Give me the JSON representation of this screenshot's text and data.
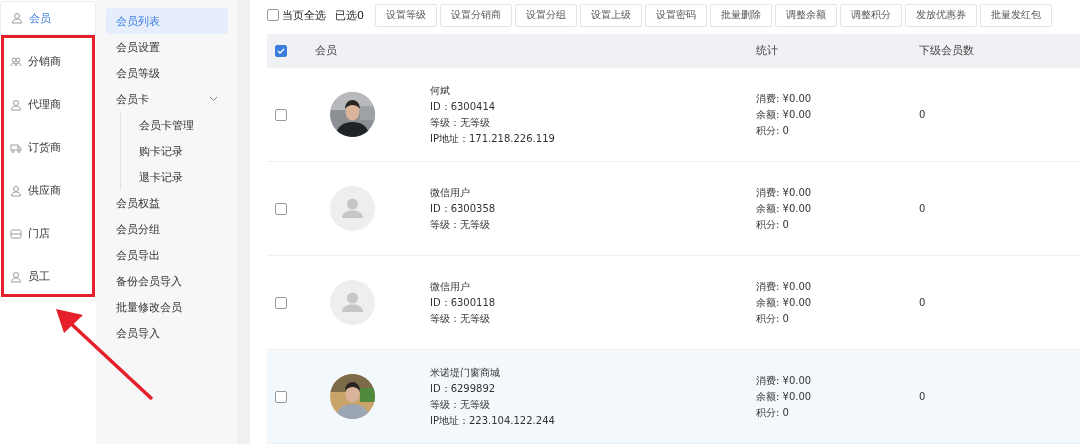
{
  "nav": [
    {
      "label": "会员",
      "kind": "user",
      "selected": true
    },
    {
      "label": "分销商",
      "kind": "group",
      "selected": false
    },
    {
      "label": "代理商",
      "kind": "user",
      "selected": false
    },
    {
      "label": "订货商",
      "kind": "truck",
      "selected": false
    },
    {
      "label": "供应商",
      "kind": "user",
      "selected": false
    },
    {
      "label": "门店",
      "kind": "store",
      "selected": false
    },
    {
      "label": "员工",
      "kind": "user",
      "selected": false
    }
  ],
  "submenu": [
    {
      "label": "会员列表",
      "selected": true
    },
    {
      "label": "会员设置",
      "selected": false
    },
    {
      "label": "会员等级",
      "selected": false
    },
    {
      "label": "会员卡",
      "selected": false,
      "expanded": true,
      "children": [
        {
          "label": "会员卡管理",
          "selected": false
        },
        {
          "label": "购卡记录",
          "selected": false
        },
        {
          "label": "退卡记录",
          "selected": false
        }
      ]
    },
    {
      "label": "会员权益",
      "selected": false
    },
    {
      "label": "会员分组",
      "selected": false
    },
    {
      "label": "会员导出",
      "selected": false
    },
    {
      "label": "备份会员导入",
      "selected": false
    },
    {
      "label": "批量修改会员",
      "selected": false
    },
    {
      "label": "会员导入",
      "selected": false
    }
  ],
  "toolbar": {
    "select_all": {
      "label": "当页全选",
      "checked": false
    },
    "selected_count": "已选0",
    "buttons": [
      "设置等级",
      "设置分销商",
      "设置分组",
      "设置上级",
      "设置密码",
      "批量删除",
      "调整余额",
      "调整积分",
      "发放优惠券",
      "批量发红包"
    ]
  },
  "table": {
    "header_checked": true,
    "columns": [
      "会员",
      "统计",
      "下级会员数"
    ],
    "rows": [
      {
        "checked": false,
        "highlighted": false,
        "avatar": {
          "kind": "picture"
        },
        "name": "何斌",
        "id": "ID：6300414",
        "level": "等级：无等级",
        "ip": "IP地址：171.218.226.119",
        "stats": [
          "消费: ¥0.00",
          "余额: ¥0.00",
          "积分: 0"
        ],
        "sub_count": "0"
      },
      {
        "checked": false,
        "highlighted": false,
        "avatar": {
          "kind": "default"
        },
        "name": "微信用户",
        "id": "ID：6300358",
        "level": "等级：无等级",
        "stats": [
          "消费: ¥0.00",
          "余额: ¥0.00",
          "积分: 0"
        ],
        "sub_count": "0"
      },
      {
        "checked": false,
        "highlighted": false,
        "avatar": {
          "kind": "default"
        },
        "name": "微信用户",
        "id": "ID：6300118",
        "level": "等级：无等级",
        "stats": [
          "消费: ¥0.00",
          "余额: ¥0.00",
          "积分: 0"
        ],
        "sub_count": "0"
      },
      {
        "checked": false,
        "highlighted": true,
        "avatar": {
          "kind": "picture"
        },
        "name": "米诺堤门窗商城",
        "id": "ID：6299892",
        "level": "等级：无等级",
        "ip": "IP地址：223.104.122.244",
        "stats": [
          "消费: ¥0.00",
          "余额: ¥0.00",
          "积分: 0"
        ],
        "sub_count": "0"
      }
    ]
  },
  "annotation": {
    "box": true,
    "arrow": true
  }
}
